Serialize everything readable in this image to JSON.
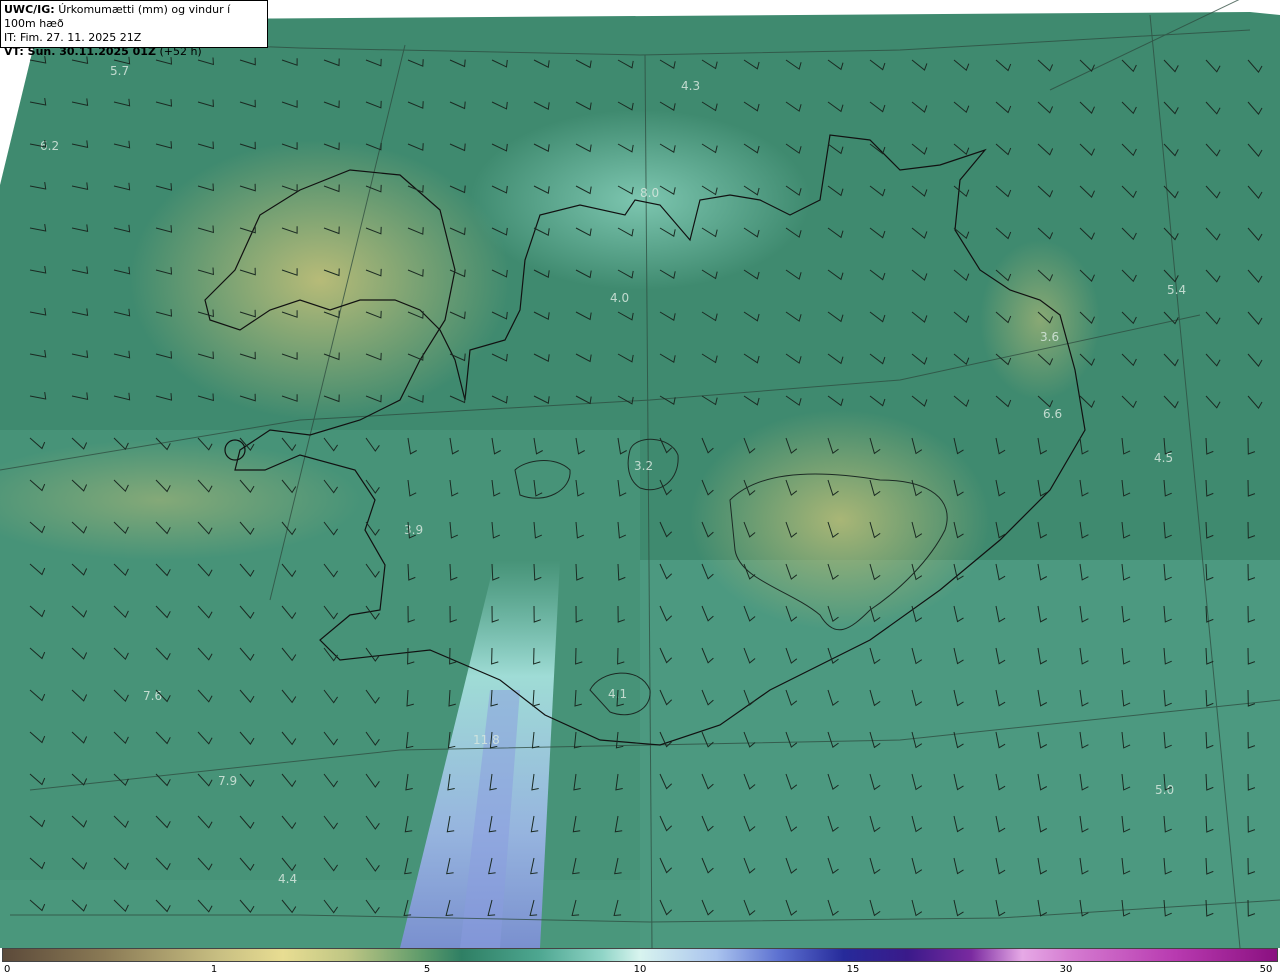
{
  "header": {
    "source": "UWC/IG:",
    "title": "Úrkomumætti (mm) og vindur í 100m hæð",
    "issue_time": "IT: Fim. 27. 11. 2025 21Z",
    "valid_prefix": "VT: Sun. 30.11.2025 01Z",
    "valid_offset": "(+52 h)"
  },
  "map_labels": [
    "5.7",
    "6.2",
    "4.3",
    "8.0",
    "4.0",
    "5.4",
    "3.6",
    "6.6",
    "3.2",
    "4.5",
    "3.9",
    "4.1",
    "7.6",
    "11.8",
    "7.9",
    "5.0",
    "4.4"
  ],
  "colorbar": {
    "ticks": [
      "0",
      "1",
      "5",
      "10",
      "15",
      "30",
      "50"
    ],
    "colors": {
      "low": "#5c4a3a",
      "dry": "#e8dd92",
      "mid": "#2f7f64",
      "wet": "#d8f4ef",
      "heavy": "#262a9a",
      "extreme": "#8a1080"
    }
  }
}
